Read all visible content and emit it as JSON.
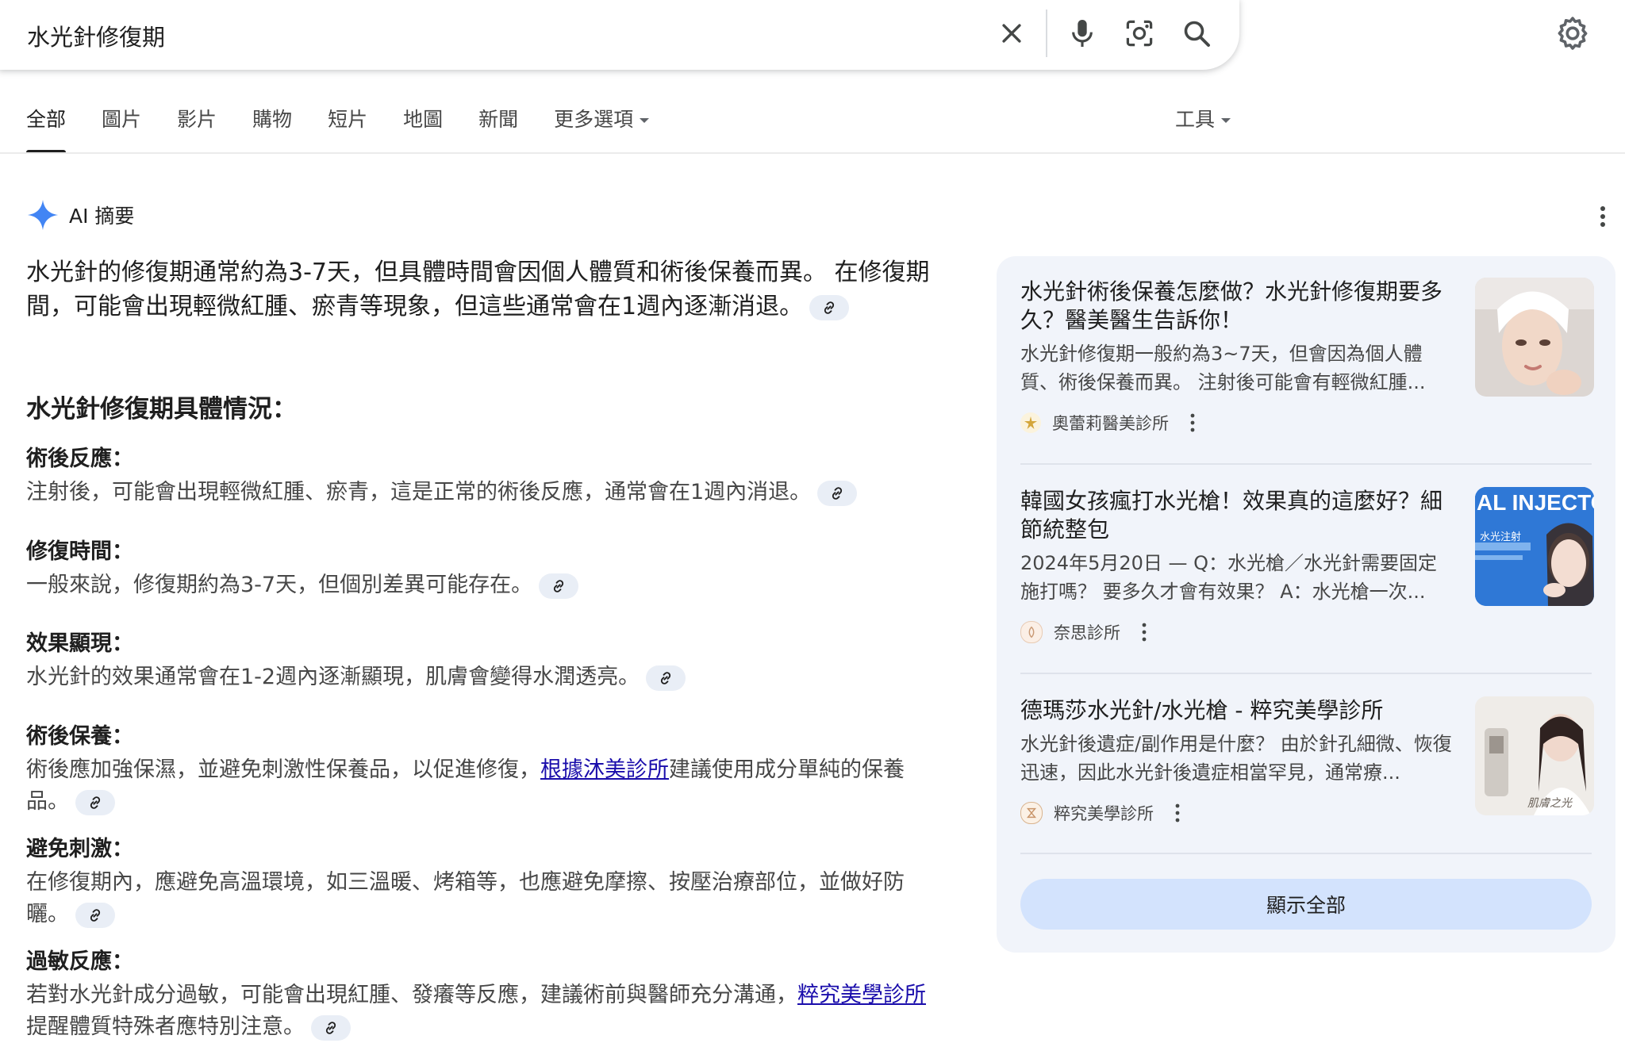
{
  "search": {
    "query": "水光針修復期",
    "icons": [
      "close-icon",
      "microphone-icon",
      "camera-lens-icon",
      "search-icon"
    ]
  },
  "settings_icon": "gear-icon",
  "tabs": [
    {
      "label": "全部",
      "active": true
    },
    {
      "label": "圖片"
    },
    {
      "label": "影片"
    },
    {
      "label": "購物"
    },
    {
      "label": "短片"
    },
    {
      "label": "地圖"
    },
    {
      "label": "新聞"
    },
    {
      "label": "更多選項"
    }
  ],
  "tools_label": "工具",
  "ai": {
    "header": "AI 摘要",
    "lead": "水光針的修復期通常約為3-7天，但具體時間會因個人體質和術後保養而異。 在修復期間，可能會出現輕微紅腫、瘀青等現象，但這些通常會在1週內逐漸消退。",
    "heading": "水光針修復期具體情況：",
    "sections": [
      {
        "title": "術後反應：",
        "body": "注射後，可能會出現輕微紅腫、瘀青，這是正常的術後反應，通常會在1週內消退。"
      },
      {
        "title": "修復時間：",
        "body": "一般來說，修復期約為3-7天，但個別差異可能存在。"
      },
      {
        "title": "效果顯現：",
        "body": "水光針的效果通常會在1-2週內逐漸顯現，肌膚會變得水潤透亮。"
      },
      {
        "title": "術後保養：",
        "body_before": "術後應加強保濕，並避免刺激性保養品，以促進修復，",
        "link": "根據沐美診所",
        "body_after": "建議使用成分單純的保養品。"
      },
      {
        "title": "避免刺激：",
        "body": "在修復期內，應避免高溫環境，如三溫暖、烤箱等，也應避免摩擦、按壓治療部位，並做好防曬。"
      },
      {
        "title": "過敏反應：",
        "body_before": "若對水光針成分過敏，可能會出現紅腫、發癢等反應，建議術前與醫師充分溝通，",
        "link": "粹究美學診所",
        "body_after": "提醒體質特殊者應特別注意。"
      }
    ]
  },
  "sources": [
    {
      "title": "水光針術後保養怎麼做？水光針修復期要多久？醫美醫生告訴你！",
      "snippet": "水光針修復期一般約為3~7天，但會因為個人體質、術後保養而異。 注射後可能會有輕微紅腫...",
      "site": "奧蕾莉醫美診所"
    },
    {
      "title": "韓國女孩瘋打水光槍！效果真的這麼好？細節統整包",
      "snippet": "2024年5月20日 — Q：水光槍／水光針需要固定施打嗎？ 要多久才會有效果？ A：水光槍一次...",
      "site": "奈思診所",
      "thumb_text": "AL INJECTO",
      "thumb_sub": "水光注射"
    },
    {
      "title": "德瑪莎水光針/水光槍 - 粹究美學診所",
      "snippet": "水光針後遺症/副作用是什麼？ 由於針孔細微、恢復迅速，因此水光針後遺症相當罕見，通常療...",
      "site": "粹究美學診所",
      "thumb_text": "肌膚之光"
    }
  ],
  "show_all": "顯示全部",
  "colors": {
    "accent": "#1a0dab",
    "chip": "#e9eef6",
    "panel": "#f1f4fa",
    "button": "#d3e3fd",
    "sparkle": "#4285f4"
  }
}
